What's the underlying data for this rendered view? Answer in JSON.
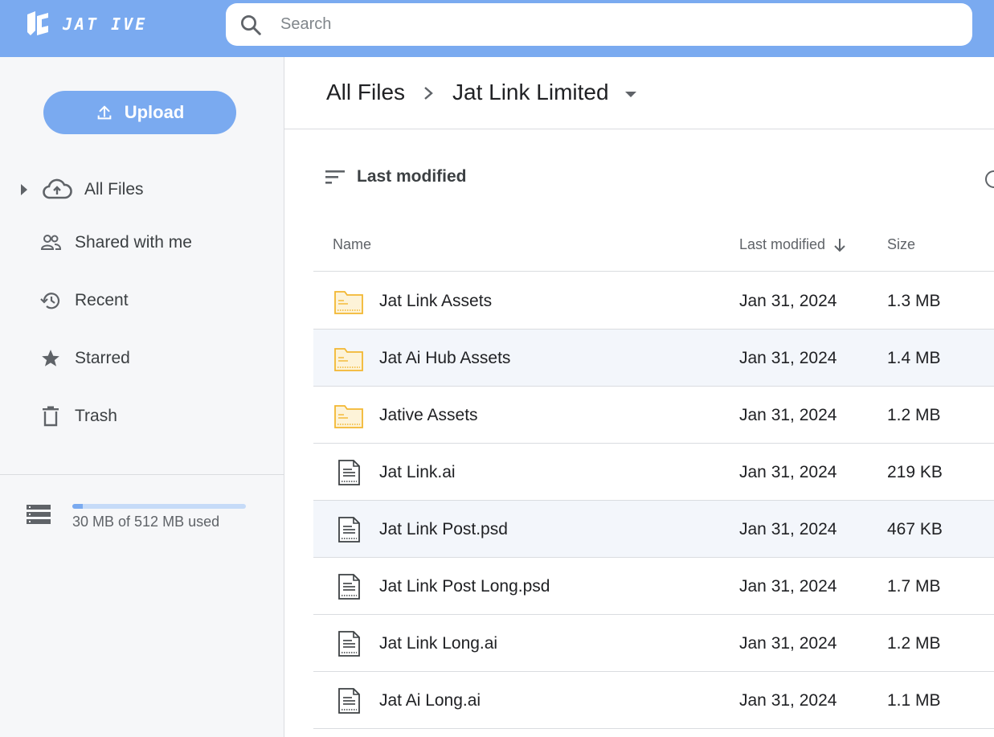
{
  "brand": {
    "name": "JAT IVE",
    "accent": "#7aaaf0"
  },
  "search": {
    "placeholder": "Search",
    "icon": "search-icon"
  },
  "sidebar": {
    "upload_label": "Upload",
    "items": [
      {
        "label": "All Files",
        "icon": "cloud-icon"
      },
      {
        "label": "Shared with me",
        "icon": "people-icon"
      },
      {
        "label": "Recent",
        "icon": "history-icon"
      },
      {
        "label": "Starred",
        "icon": "star-icon"
      },
      {
        "label": "Trash",
        "icon": "trash-icon"
      }
    ],
    "storage": {
      "text": "30 MB of 512 MB used",
      "used_fraction": 0.06
    }
  },
  "breadcrumb": {
    "root": "All Files",
    "current": "Jat Link Limited"
  },
  "sort": {
    "label": "Last modified"
  },
  "table": {
    "columns": {
      "name": "Name",
      "modified": "Last modified",
      "size": "Size"
    },
    "rows": [
      {
        "type": "folder",
        "name": "Jat Link Assets",
        "modified": "Jan 31, 2024",
        "size": "1.3 MB"
      },
      {
        "type": "folder",
        "name": "Jat Ai Hub Assets",
        "modified": "Jan 31, 2024",
        "size": "1.4 MB"
      },
      {
        "type": "folder",
        "name": "Jative Assets",
        "modified": "Jan 31, 2024",
        "size": "1.2 MB"
      },
      {
        "type": "file",
        "name": "Jat Link.ai",
        "modified": "Jan 31, 2024",
        "size": "219 KB"
      },
      {
        "type": "file",
        "name": "Jat Link Post.psd",
        "modified": "Jan 31, 2024",
        "size": "467 KB"
      },
      {
        "type": "file",
        "name": "Jat Link Post Long.psd",
        "modified": "Jan 31, 2024",
        "size": "1.7 MB"
      },
      {
        "type": "file",
        "name": "Jat Link Long.ai",
        "modified": "Jan 31, 2024",
        "size": "1.2 MB"
      },
      {
        "type": "file",
        "name": "Jat Ai Long.ai",
        "modified": "Jan 31, 2024",
        "size": "1.1 MB"
      }
    ]
  }
}
